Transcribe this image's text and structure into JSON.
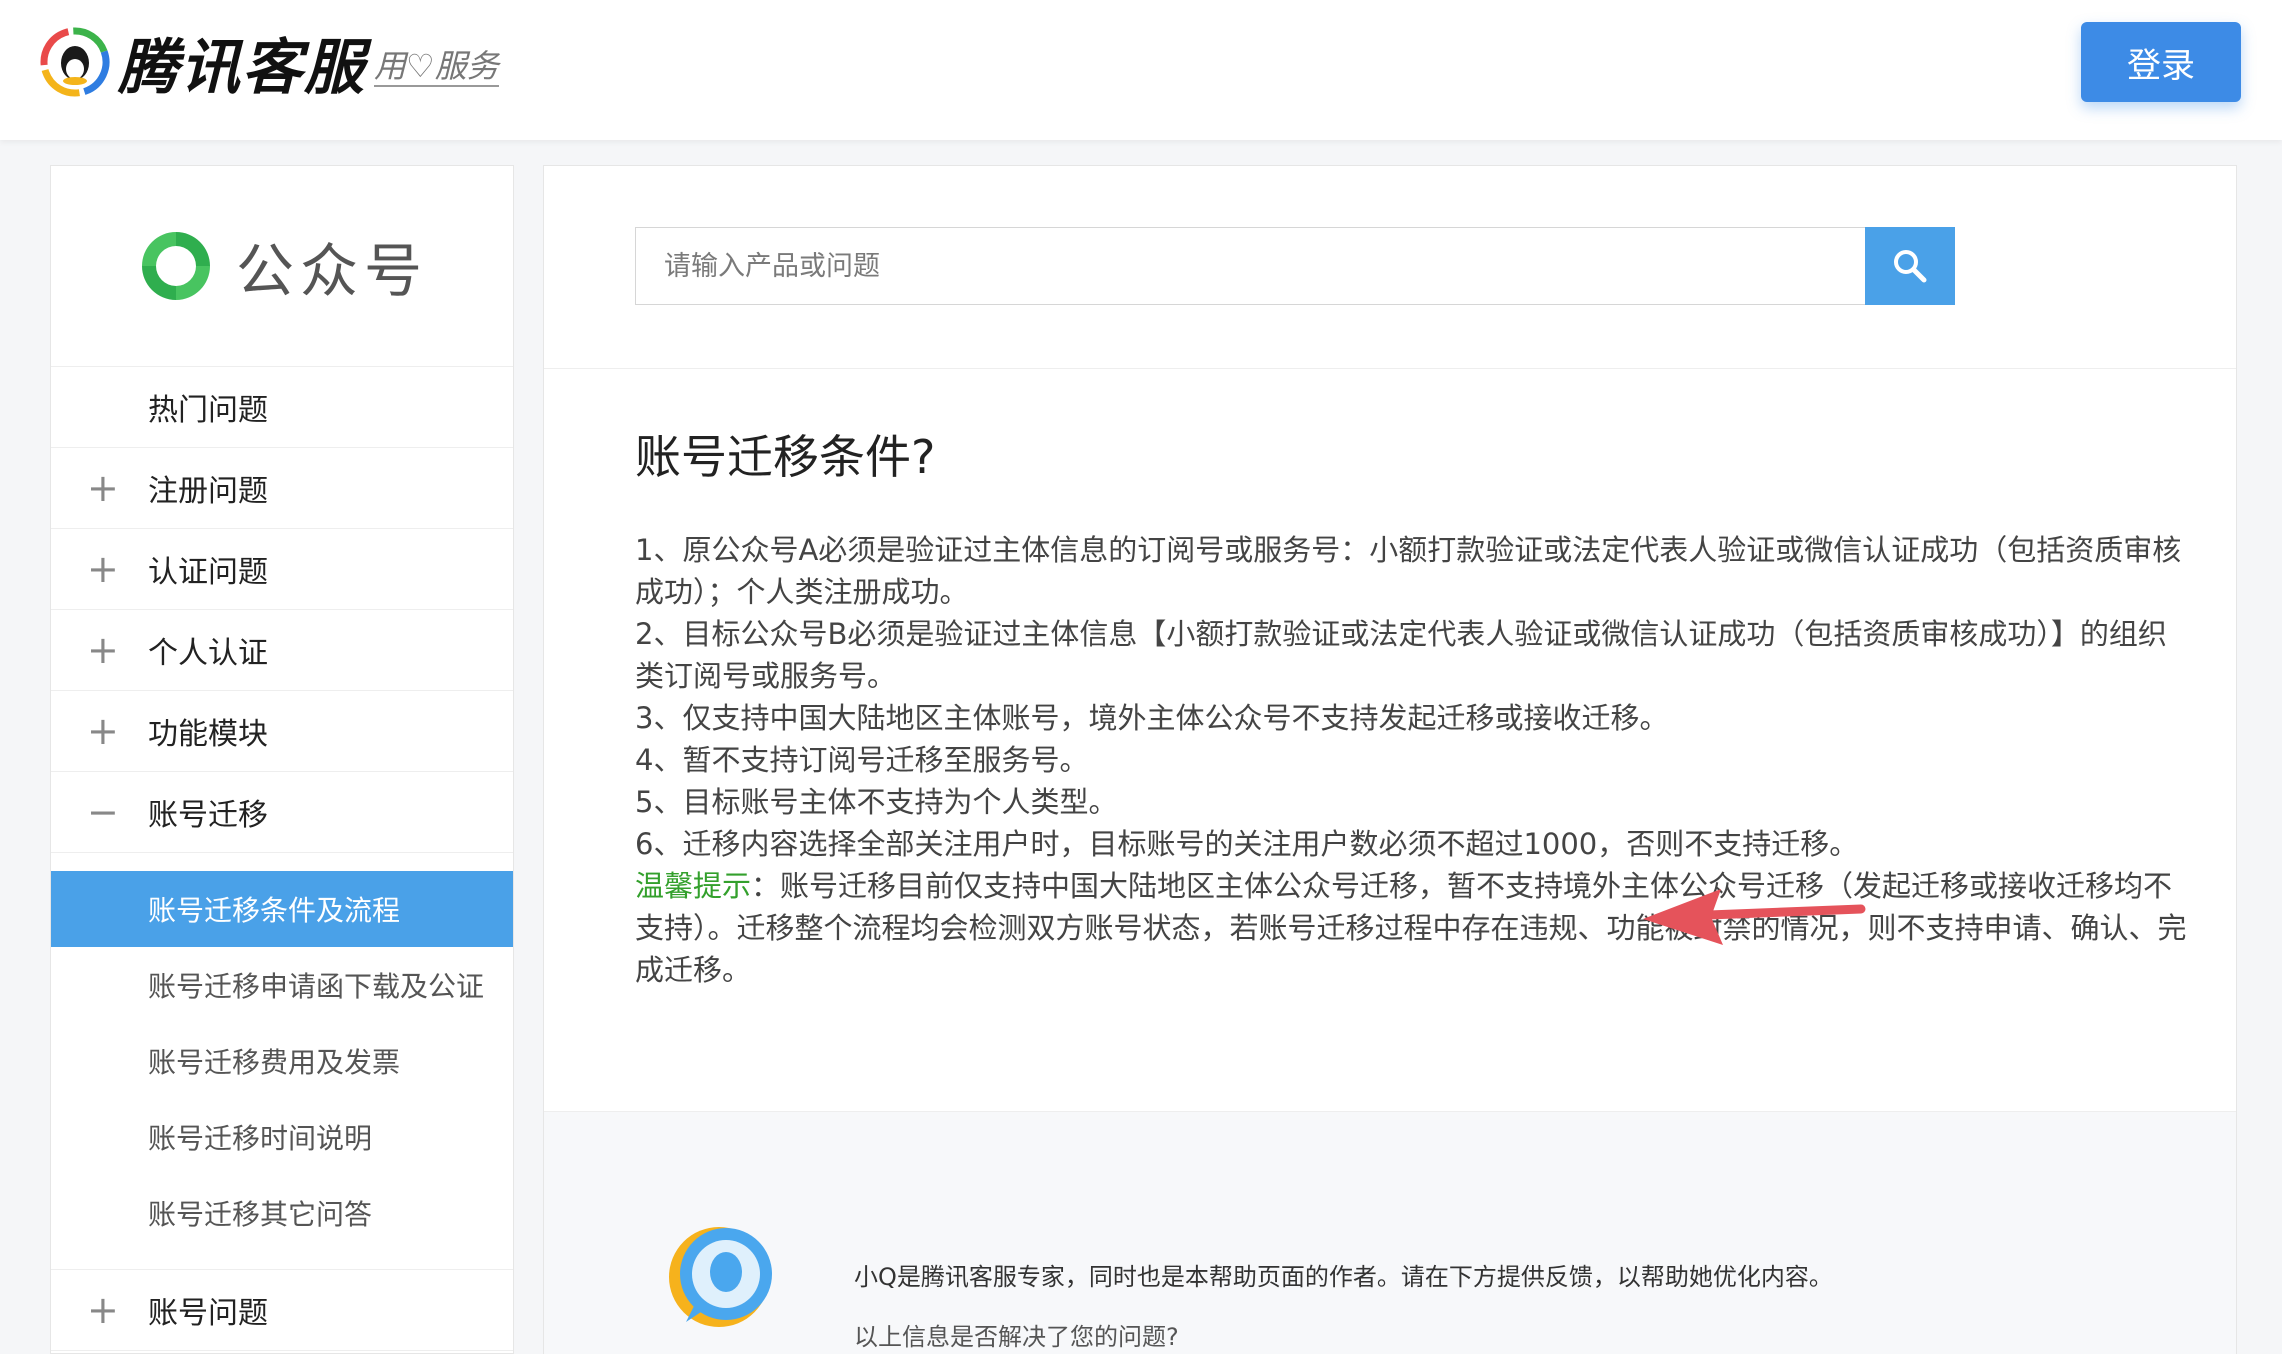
{
  "header": {
    "brand_name": "腾讯客服",
    "slogan": "用♡服务",
    "login_label": "登录"
  },
  "sidebar": {
    "product_name": "公众号",
    "items": [
      {
        "sign": "",
        "label": "热门问题"
      },
      {
        "sign": "+",
        "label": "注册问题"
      },
      {
        "sign": "+",
        "label": "认证问题"
      },
      {
        "sign": "+",
        "label": "个人认证"
      },
      {
        "sign": "+",
        "label": "功能模块"
      },
      {
        "sign": "−",
        "label": "账号迁移"
      }
    ],
    "sub_items": [
      {
        "label": "账号迁移条件及流程",
        "active": true
      },
      {
        "label": "账号迁移申请函下载及公证",
        "active": false
      },
      {
        "label": "账号迁移费用及发票",
        "active": false
      },
      {
        "label": "账号迁移时间说明",
        "active": false
      },
      {
        "label": "账号迁移其它问答",
        "active": false
      }
    ],
    "bottom_item": {
      "sign": "+",
      "label": "账号问题"
    }
  },
  "search": {
    "placeholder": "请输入产品或问题",
    "icon": "search-icon"
  },
  "article": {
    "title": "账号迁移条件?",
    "paragraphs": [
      "1、原公众号A必须是验证过主体信息的订阅号或服务号：小额打款验证或法定代表人验证或微信认证成功（包括资质审核成功）；个人类注册成功。",
      "2、目标公众号B必须是验证过主体信息【小额打款验证或法定代表人验证或微信认证成功（包括资质审核成功）】的组织类订阅号或服务号。",
      "3、仅支持中国大陆地区主体账号，境外主体公众号不支持发起迁移或接收迁移。",
      "4、暂不支持订阅号迁移至服务号。",
      "5、目标账号主体不支持为个人类型。",
      "6、迁移内容选择全部关注用户时，目标账号的关注用户数必须不超过1000，否则不支持迁移。"
    ],
    "tip_label": "温馨提示",
    "tip_text": "：账号迁移目前仅支持中国大陆地区主体公众号迁移，暂不支持境外主体公众号迁移（发起迁移或接收迁移均不支持）。迁移整个流程均会检测双方账号状态，若账号迁移过程中存在违规、功能被封禁的情况，则不支持申请、确认、完成迁移。"
  },
  "feedback": {
    "intro": "小Q是腾讯客服专家，同时也是本帮助页面的作者。请在下方提供反馈，以帮助她优化内容。",
    "question": "以上信息是否解决了您的问题?"
  },
  "colors": {
    "accent": "#4aa1e8",
    "login": "#3d8be6",
    "tip": "#33a02c",
    "arrow": "#e5535b"
  }
}
